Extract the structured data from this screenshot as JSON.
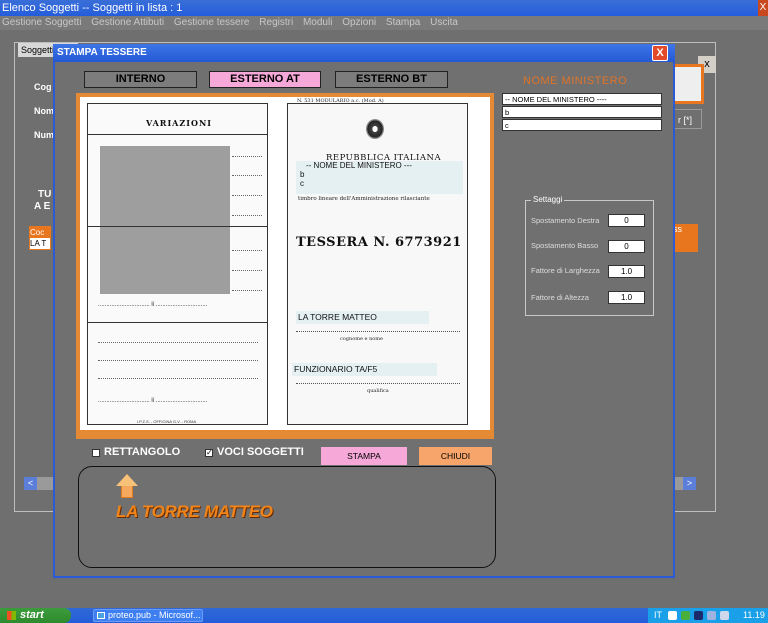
{
  "app": {
    "title": "Elenco Soggetti -- Soggetti in lista : 1",
    "close_label": "X",
    "menu": [
      "Gestione Soggetti",
      "Gestione Attibuti",
      "Gestione tessere",
      "Registri",
      "Moduli",
      "Opzioni",
      "Stampa",
      "Uscita"
    ]
  },
  "background_form": {
    "tab_label": "Soggetti",
    "labels": [
      "Cog",
      "Nom",
      "Num",
      "TU",
      "A E"
    ],
    "right_button": "r [*]",
    "close_label": "x",
    "list_header_left": "Coc",
    "list_row_left": "LA T",
    "list_header_right": "ess",
    "scroll_left": "<",
    "scroll_right": ">"
  },
  "dialog": {
    "title": "STAMPA TESSERE",
    "close_label": "X",
    "tabs": [
      "INTERNO",
      "ESTERNO AT",
      "ESTERNO BT"
    ],
    "card": {
      "variazioni": "VARIAZIONI",
      "top_form": "N. 531 MODULARIO a.c.      (Mod. A)",
      "repubblica": "REPUBBLICA ITALIANA",
      "ministero_lines": [
        "-- NOME DEL MINISTERO ---",
        "b",
        "c"
      ],
      "timbro": "timbro lineare dell'Amministrazione rilasciante",
      "tessera": "TESSERA N. 6773921",
      "holder": "LA TORRE MATTEO",
      "cognome_caption": "cognome e nome",
      "funzionario": "FUNZIONARIO TA/F5",
      "qualifica_caption": "qualifica",
      "footer": "I.P.Z.S. - OFFICINA G.V. - ROMA",
      "signature_left_1": "...............................  li  ...............................",
      "signature_left_2": "...............................  li  ..............................."
    },
    "nome_ministero": {
      "label": "NOME MINISTERO",
      "fields": [
        "-- NOME DEL MINISTERO ----",
        "b",
        "c"
      ]
    },
    "settaggi": {
      "legend": "Settaggi",
      "rows": [
        {
          "label": "Spostamento Destra",
          "value": "0"
        },
        {
          "label": "Spostamento Basso",
          "value": "0"
        },
        {
          "label": "Fattore di Larghezza",
          "value": "1.0"
        },
        {
          "label": "Fattore di Altezza",
          "value": "1.0"
        }
      ]
    },
    "checkboxes": [
      {
        "label": "RETTANGOLO",
        "checked": false
      },
      {
        "label": "VOCI SOGGETTI",
        "checked": true
      }
    ],
    "stampa_label": "STAMPA",
    "chiudi_label": "CHIUDI",
    "selected_name": "LA TORRE MATTEO"
  },
  "taskbar": {
    "start_label": "start",
    "task_item": "proteo.pub - Microsof...",
    "language": "IT",
    "time": "11.19"
  }
}
